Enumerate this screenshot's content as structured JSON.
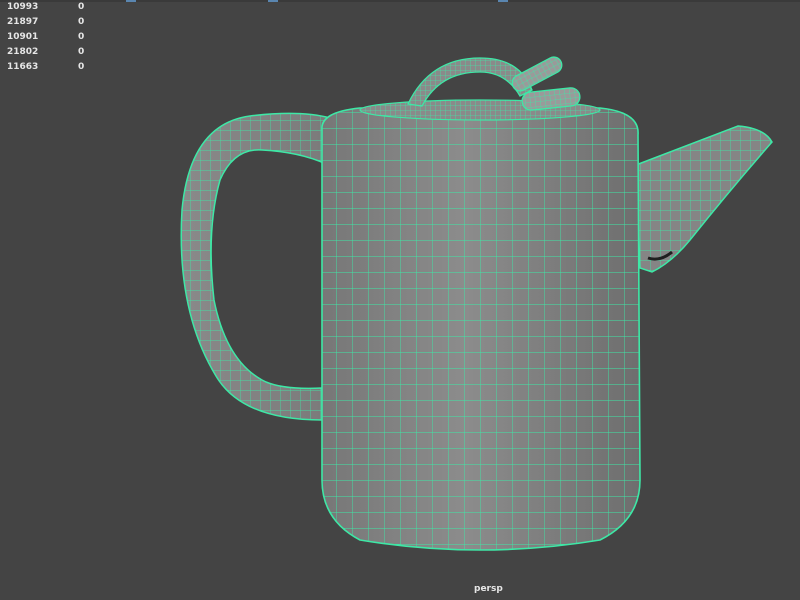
{
  "viewport": {
    "camera_label": "persp",
    "background_color": "#444444",
    "wireframe_color": "#3ee8a6",
    "surface_color": "#8a8a8a"
  },
  "hud": {
    "rows": [
      {
        "value": "10993",
        "count": "0"
      },
      {
        "value": "21897",
        "count": "0"
      },
      {
        "value": "10901",
        "count": "0"
      },
      {
        "value": "21802",
        "count": "0"
      },
      {
        "value": "11663",
        "count": "0"
      }
    ]
  },
  "scene": {
    "object": "teapot-icon"
  }
}
